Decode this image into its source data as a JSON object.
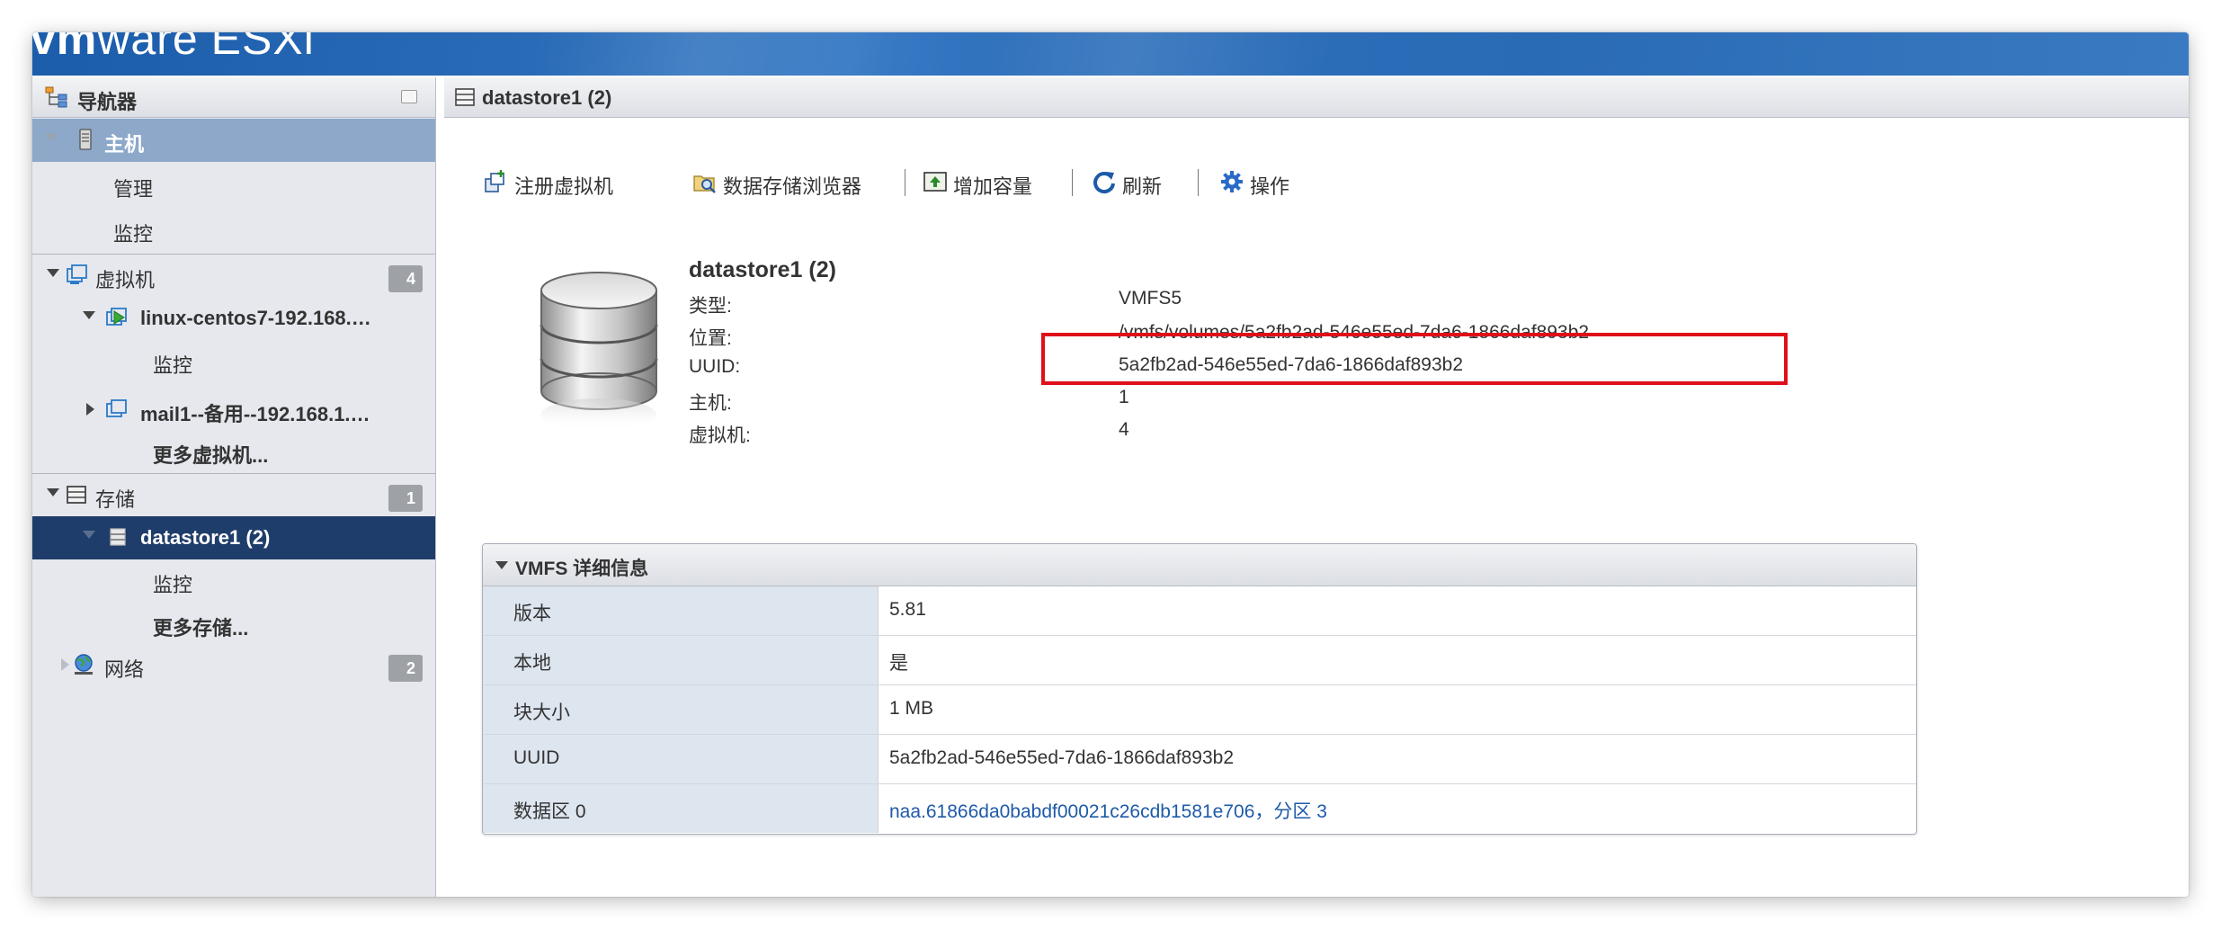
{
  "banner": {
    "logo_vm": "vm",
    "logo_ware": "ware",
    "product": "ESXi"
  },
  "navigator": {
    "title": "导航器",
    "host": {
      "label": "主机",
      "children": [
        "管理",
        "监控"
      ]
    },
    "vms": {
      "label": "虚拟机",
      "count": "4",
      "items": [
        {
          "label": "linux-centos7-192.168.…",
          "children": [
            "监控"
          ]
        },
        {
          "label": "mail1--备用--192.168.1.…"
        }
      ],
      "more": "更多虚拟机..."
    },
    "storage": {
      "label": "存储",
      "count": "1",
      "selected": "datastore1 (2)",
      "children": [
        "监控"
      ],
      "more": "更多存储..."
    },
    "network": {
      "label": "网络",
      "count": "2"
    }
  },
  "main": {
    "header_title": "datastore1 (2)",
    "toolbar": {
      "register_vm": "注册虚拟机",
      "datastore_browser": "数据存储浏览器",
      "increase_capacity": "增加容量",
      "refresh": "刷新",
      "actions": "操作"
    },
    "summary": {
      "name": "datastore1 (2)",
      "rows": [
        {
          "label": "类型:",
          "value": "VMFS5"
        },
        {
          "label": "位置:",
          "value": "/vmfs/volumes/5a2fb2ad-546e55ed-7da6-1866daf893b2"
        },
        {
          "label": "UUID:",
          "value": "5a2fb2ad-546e55ed-7da6-1866daf893b2"
        },
        {
          "label": "主机:",
          "value": "1"
        },
        {
          "label": "虚拟机:",
          "value": "4"
        }
      ]
    },
    "vmfs_details": {
      "title": "VMFS 详细信息",
      "rows": [
        {
          "label": "版本",
          "value": "5.81"
        },
        {
          "label": "本地",
          "value": "是"
        },
        {
          "label": "块大小",
          "value": "1 MB"
        },
        {
          "label": "UUID",
          "value": "5a2fb2ad-546e55ed-7da6-1866daf893b2"
        },
        {
          "label": "数据区 0",
          "value": "naa.61866da0babdf00021c26cdb1581e706，分区 3"
        }
      ]
    }
  },
  "colors": {
    "banner": "#2a6bb6",
    "selected": "#1f3d6a",
    "highlight": "#e0101a",
    "link": "#1e5aa8"
  }
}
